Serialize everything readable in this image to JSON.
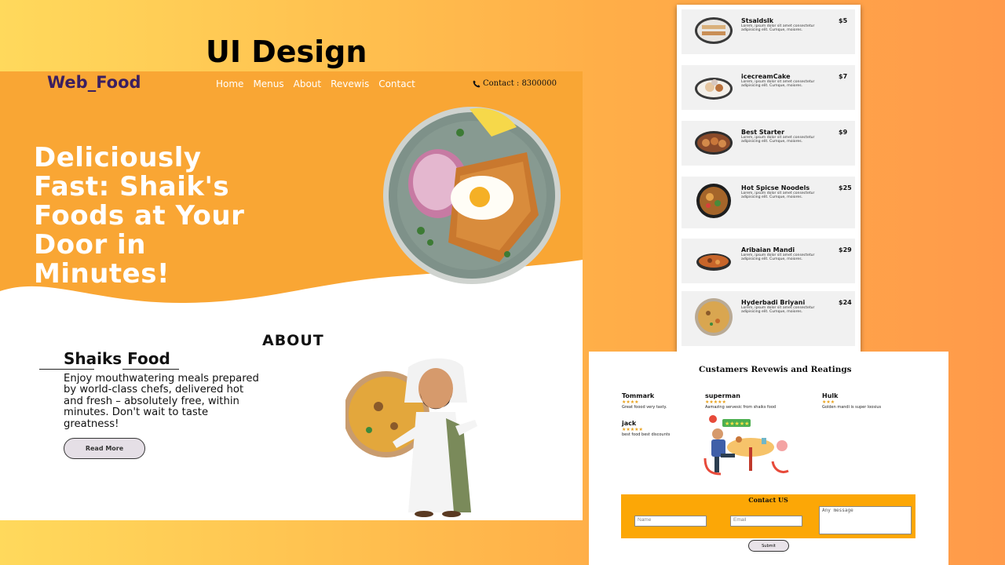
{
  "stage_title": "UI Design",
  "site": {
    "logo": "Web_Food",
    "nav": [
      "Home",
      "Menus",
      "About",
      "Revewis",
      "Contact"
    ],
    "contact": "Contact : 8300000",
    "hero_heading": "Deliciously Fast: Shaik's Foods at Your Door in Minutes!",
    "about_title": "ABOUT",
    "about_name": "Shaiks Food",
    "about_text": "Enjoy mouthwatering meals prepared by world-class chefs, delivered hot and fresh – absolutely free, within minutes. Don't wait to taste greatness!",
    "read_more": "Read More"
  },
  "menu": {
    "items": [
      {
        "name": "Stsaldslk",
        "price": "$5",
        "desc": "Lorem, ipsum dolor sit amet consectetur adipisicing elit. Cumque, moiores."
      },
      {
        "name": "icecreamCake",
        "price": "$7",
        "desc": "Lorem, ipsum dolor sit amet consectetur adipisicing elit. Cumque, moiores."
      },
      {
        "name": "Best Starter",
        "price": "$9",
        "desc": "Lorem, ipsum dolor sit amet consectetur adipisicing elit. Cumque, moiores."
      },
      {
        "name": "Hot Spicse Noodels",
        "price": "$25",
        "desc": "Lorem, ipsum dolor sit amet consectetur adipisicing elit. Cumque, moiores."
      },
      {
        "name": "Aribaian Mandi",
        "price": "$29",
        "desc": "Lorem, ipsum dolor sit amet consectetur adipisicing elit. Cumque, moiores."
      },
      {
        "name": "Hyderbadi Briyani",
        "price": "$24",
        "desc": "Lorem, ipsum dolor sit amet consectetur adipisicing elit. Cumque, moiores."
      }
    ]
  },
  "reviews": {
    "title": "Custamers Revewis and Reatings",
    "items": [
      {
        "name": "Tommark",
        "stars": "★★★★",
        "text": "Great foood very tasty."
      },
      {
        "name": "superman",
        "stars": "★★★★★",
        "text": "Aamazing servesic from shaiks food"
      },
      {
        "name": "Hulk",
        "stars": "★★★",
        "text": "Golden mandi is super loosius"
      },
      {
        "name": "jack",
        "stars": "★★★★★",
        "text": "best food best discounts"
      }
    ]
  },
  "contact_form": {
    "title": "Contact US",
    "name_placeholder": "Name",
    "email_placeholder": "Email",
    "message_placeholder": "Any message",
    "submit": "Submit"
  },
  "colors": {
    "hero_orange": "#f9a634",
    "logo_purple": "#3b1f60",
    "contact_orange": "#fca706",
    "star": "#e8a11a"
  }
}
